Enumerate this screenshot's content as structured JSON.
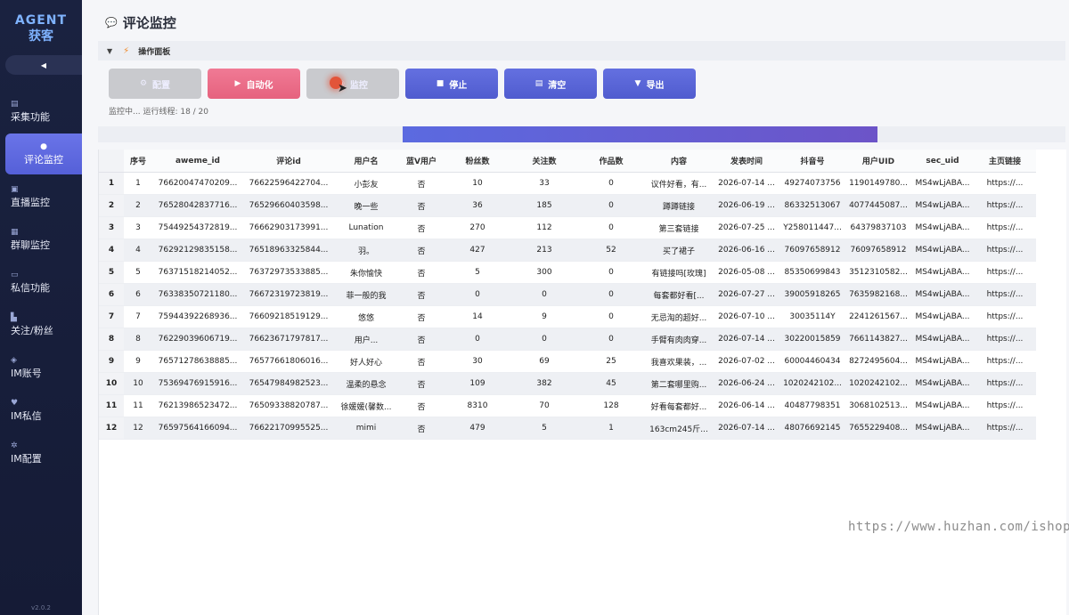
{
  "sidebar": {
    "logo_line1": "AGENT",
    "logo_line2": "获客",
    "collapse_symbol": "◀",
    "items": [
      {
        "label": "采集功能",
        "icon": "collect-icon",
        "glyph": "▤",
        "active": false
      },
      {
        "label": "评论监控",
        "icon": "comment-icon",
        "glyph": "●",
        "active": true
      },
      {
        "label": "直播监控",
        "icon": "live-icon",
        "glyph": "▣",
        "active": false
      },
      {
        "label": "群聊监控",
        "icon": "group-icon",
        "glyph": "▦",
        "active": false
      },
      {
        "label": "私信功能",
        "icon": "message-icon",
        "glyph": "▭",
        "active": false
      },
      {
        "label": "关注/粉丝",
        "icon": "follow-icon",
        "glyph": "▙",
        "active": false
      },
      {
        "label": "IM账号",
        "icon": "im-account-icon",
        "glyph": "◈",
        "active": false
      },
      {
        "label": "IM私信",
        "icon": "im-message-icon",
        "glyph": "♥",
        "active": false
      },
      {
        "label": "IM配置",
        "icon": "settings-icon",
        "glyph": "✲",
        "active": false
      }
    ],
    "version": "v2.0.2"
  },
  "header": {
    "title": "评论监控",
    "icon": "chat-bubble-icon"
  },
  "panel": {
    "toggle": "▼",
    "title": "操作面板",
    "icon": "bolt-icon"
  },
  "toolbar": {
    "buttons": [
      {
        "label": "配置",
        "glyph": "⚙",
        "style": "gray",
        "name": "config-button"
      },
      {
        "label": "自动化",
        "glyph": "▶",
        "style": "pink",
        "name": "automation-button"
      },
      {
        "label": "监控",
        "glyph": "◉",
        "style": "gray",
        "name": "monitor-button"
      },
      {
        "label": "停止",
        "glyph": "■",
        "style": "blue",
        "name": "stop-button"
      },
      {
        "label": "清空",
        "glyph": "▤",
        "style": "blue",
        "name": "clear-button"
      },
      {
        "label": "导出",
        "glyph": "▼",
        "style": "blue",
        "name": "export-button"
      }
    ]
  },
  "status": {
    "text": "监控中... 运行线程: 18 / 20"
  },
  "progress": {
    "start": 0.315,
    "end": 0.806
  },
  "table": {
    "columns": [
      "序号",
      "aweme_id",
      "评论id",
      "用户名",
      "蓝V用户",
      "粉丝数",
      "关注数",
      "作品数",
      "内容",
      "发表时间",
      "抖音号",
      "用户UID",
      "sec_uid",
      "主页链接"
    ],
    "rows": [
      [
        "1",
        "1",
        "76620047470209...",
        "76622596422704...",
        "小彭友",
        "否",
        "10",
        "33",
        "0",
        "议件好看，有...",
        "2026-07-14 ...",
        "49274073756",
        "1190149780...",
        "MS4wLjABA...",
        "https://..."
      ],
      [
        "2",
        "2",
        "76528042837716...",
        "76529660403598...",
        "晚一些",
        "否",
        "36",
        "185",
        "0",
        "蹲蹲链接",
        "2026-06-19 ...",
        "86332513067",
        "4077445087...",
        "MS4wLjABA...",
        "https://..."
      ],
      [
        "3",
        "3",
        "75449254372819...",
        "76662903173991...",
        "Lunation",
        "否",
        "270",
        "112",
        "0",
        "第三套链接",
        "2026-07-25 ...",
        "Y258011447...",
        "64379837103",
        "MS4wLjABA...",
        "https://..."
      ],
      [
        "4",
        "4",
        "76292129835158...",
        "76518963325844...",
        "羽。",
        "否",
        "427",
        "213",
        "52",
        "买了裙子",
        "2026-06-16 ...",
        "76097658912",
        "76097658912",
        "MS4wLjABA...",
        "https://..."
      ],
      [
        "5",
        "5",
        "76371518214052...",
        "76372973533885...",
        "朱你愉快",
        "否",
        "5",
        "300",
        "0",
        "有链接吗[玫瑰]",
        "2026-05-08 ...",
        "85350699843",
        "3512310582...",
        "MS4wLjABA...",
        "https://..."
      ],
      [
        "6",
        "6",
        "76338350721180...",
        "76672319723819...",
        "菲一般的我",
        "否",
        "0",
        "0",
        "0",
        "每套都好看[...",
        "2026-07-27 ...",
        "39005918265",
        "7635982168...",
        "MS4wLjABA...",
        "https://..."
      ],
      [
        "7",
        "7",
        "75944392268936...",
        "76609218519129...",
        "悠悠",
        "否",
        "14",
        "9",
        "0",
        "无忌淘的超好...",
        "2026-07-10 ...",
        "30035114Y",
        "2241261567...",
        "MS4wLjABA...",
        "https://..."
      ],
      [
        "8",
        "8",
        "76229039606719...",
        "76623671797817...",
        "用户...",
        "否",
        "0",
        "0",
        "0",
        "手臂有肉肉穿...",
        "2026-07-14 ...",
        "30220015859",
        "7661143827...",
        "MS4wLjABA...",
        "https://..."
      ],
      [
        "9",
        "9",
        "76571278638885...",
        "76577661806016...",
        "好人好心",
        "否",
        "30",
        "69",
        "25",
        "我喜欢果装，...",
        "2026-07-02 ...",
        "60004460434",
        "8272495604...",
        "MS4wLjABA...",
        "https://..."
      ],
      [
        "10",
        "10",
        "75369476915916...",
        "76547984982523...",
        "温柔的悬念",
        "否",
        "109",
        "382",
        "45",
        "第二套哪里购...",
        "2026-06-24 ...",
        "1020242102...",
        "1020242102...",
        "MS4wLjABA...",
        "https://..."
      ],
      [
        "11",
        "11",
        "76213986523472...",
        "76509338820787...",
        "徐媛媛(馨数...",
        "否",
        "8310",
        "70",
        "128",
        "好看每套都好...",
        "2026-06-14 ...",
        "40487798351",
        "3068102513...",
        "MS4wLjABA...",
        "https://..."
      ],
      [
        "12",
        "12",
        "76597564166094...",
        "76622170995525...",
        "mimi",
        "否",
        "479",
        "5",
        "1",
        "163cm245斤...",
        "2026-07-14 ...",
        "48076692145",
        "7655229408...",
        "MS4wLjABA...",
        "https://..."
      ]
    ]
  },
  "watermark": "https://www.huzhan.com/ishop54875"
}
